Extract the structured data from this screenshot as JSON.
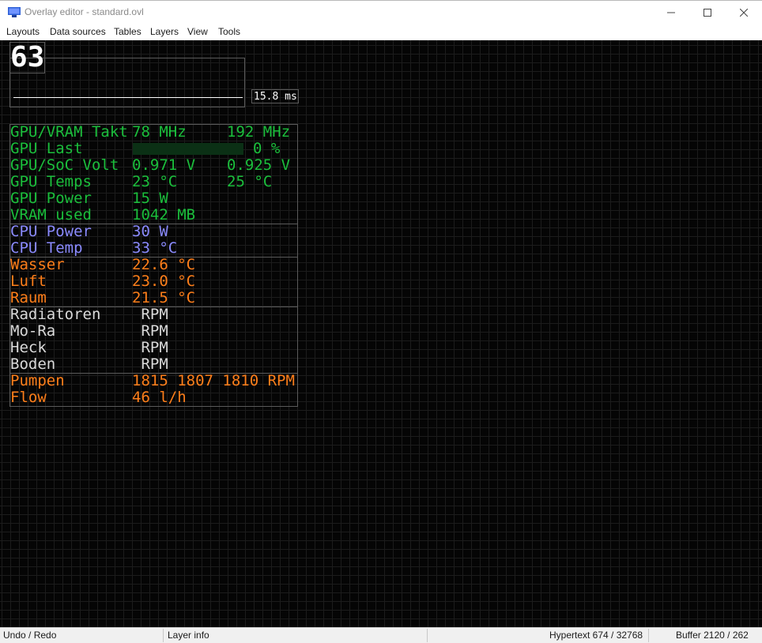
{
  "window": {
    "title": "Overlay editor - standard.ovl",
    "minimize_glyph": "—",
    "maximize_glyph": "☐",
    "close_glyph": "✕",
    "icon": "monitor-icon"
  },
  "menu": [
    {
      "label": "Layouts"
    },
    {
      "label": "Data sources"
    },
    {
      "label": "Tables"
    },
    {
      "label": "Layers"
    },
    {
      "label": "View"
    },
    {
      "label": "Tools"
    }
  ],
  "overlay": {
    "fps": "63",
    "frametime": "15.8 ms",
    "groups": [
      {
        "color": "green",
        "rows": [
          {
            "label": "GPU/VRAM Takt",
            "v1": "78 MHz",
            "v2": "192 MHz"
          },
          {
            "label": "GPU Last",
            "v1": "",
            "v2": "0 %",
            "load_percent": 0
          },
          {
            "label": "GPU/SoC Volt",
            "v1": "0.971 V",
            "v2": "0.925 V"
          },
          {
            "label": "GPU Temps",
            "v1": "23 °C",
            "v2": "25 °C"
          },
          {
            "label": "GPU Power",
            "v1": "15 W",
            "v2": ""
          },
          {
            "label": "VRAM used",
            "v1": "1042 MB",
            "v2": ""
          }
        ]
      },
      {
        "color": "blue",
        "rows": [
          {
            "label": "CPU Power",
            "v1": "30 W",
            "v2": ""
          },
          {
            "label": "CPU Temp",
            "v1": "33 °C",
            "v2": ""
          }
        ]
      },
      {
        "color": "orange",
        "rows": [
          {
            "label": "Wasser",
            "v1": "22.6 °C",
            "v2": ""
          },
          {
            "label": "Luft",
            "v1": "23.0 °C",
            "v2": ""
          },
          {
            "label": "Raum",
            "v1": "21.5 °C",
            "v2": ""
          }
        ]
      },
      {
        "color": "white",
        "rows": [
          {
            "label": "Radiatoren",
            "v1": " RPM",
            "v2": ""
          },
          {
            "label": "Mo-Ra",
            "v1": " RPM",
            "v2": ""
          },
          {
            "label": "Heck",
            "v1": " RPM",
            "v2": ""
          },
          {
            "label": "Boden",
            "v1": " RPM",
            "v2": ""
          }
        ]
      },
      {
        "color": "orange",
        "rows": [
          {
            "label": "Pumpen",
            "v1": "1815 1807 1810 RPM",
            "v2": ""
          },
          {
            "label": "Flow",
            "v1": "46 l/h",
            "v2": ""
          }
        ]
      }
    ]
  },
  "status": {
    "undo_redo": "Undo / Redo",
    "layer_info": "Layer info",
    "hypertext": "Hypertext 674 / 32768",
    "buffer": "Buffer 2120 / 262"
  },
  "colors": {
    "green": "#1bbf3c",
    "blue": "#8b8bff",
    "orange": "#ff7f1a",
    "white": "#dadada"
  }
}
